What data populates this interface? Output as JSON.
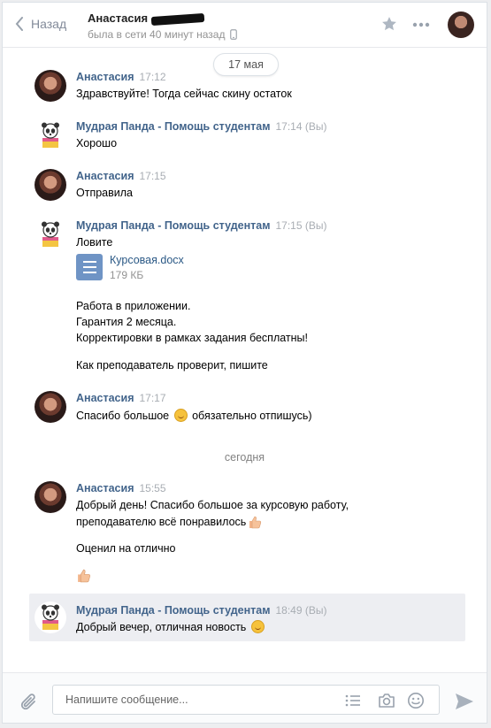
{
  "header": {
    "back_label": "Назад",
    "contact_name": "Анастасия",
    "status_text": "была в сети 40 минут назад"
  },
  "separators": {
    "date_pill": "17 мая",
    "today": "сегодня"
  },
  "messages": [
    {
      "author": "Анастасия",
      "time": "17:12",
      "lines": [
        "Здравствуйте! Тогда сейчас скину остаток"
      ]
    },
    {
      "author": "Мудрая Панда - Помощь студентам",
      "time": "17:14 (Вы)",
      "lines": [
        "Хорошо"
      ]
    },
    {
      "author": "Анастасия",
      "time": "17:15",
      "lines": [
        "Отправила"
      ]
    },
    {
      "author": "Мудрая Панда - Помощь студентам",
      "time": "17:15 (Вы)",
      "lines": [
        "Ловите",
        "Работа в приложении.",
        "Гарантия 2 месяца.",
        "Корректировки в рамках задания бесплатны!",
        "Как преподаватель проверит, пишите"
      ],
      "attachment": {
        "name": "Курсовая.docx",
        "size": "179 КБ"
      }
    },
    {
      "author": "Анастасия",
      "time": "17:17",
      "lines": [
        "Спасибо большое",
        "обязательно отпишусь)"
      ]
    },
    {
      "author": "Анастасия",
      "time": "15:55",
      "lines": [
        "Добрый день! Спасибо большое за курсовую работу,",
        "преподавателю всё понравилось",
        "Оценил на отлично"
      ]
    },
    {
      "author": "Мудрая Панда - Помощь студентам",
      "time": "18:49 (Вы)",
      "lines": [
        "Добрый вечер, отличная новость"
      ]
    }
  ],
  "composer": {
    "placeholder": "Напишите сообщение..."
  },
  "colors": {
    "link": "#42648b",
    "accent": "#5181b8",
    "doc_icon": "#6f94c5",
    "highlight": "#edeef2"
  }
}
